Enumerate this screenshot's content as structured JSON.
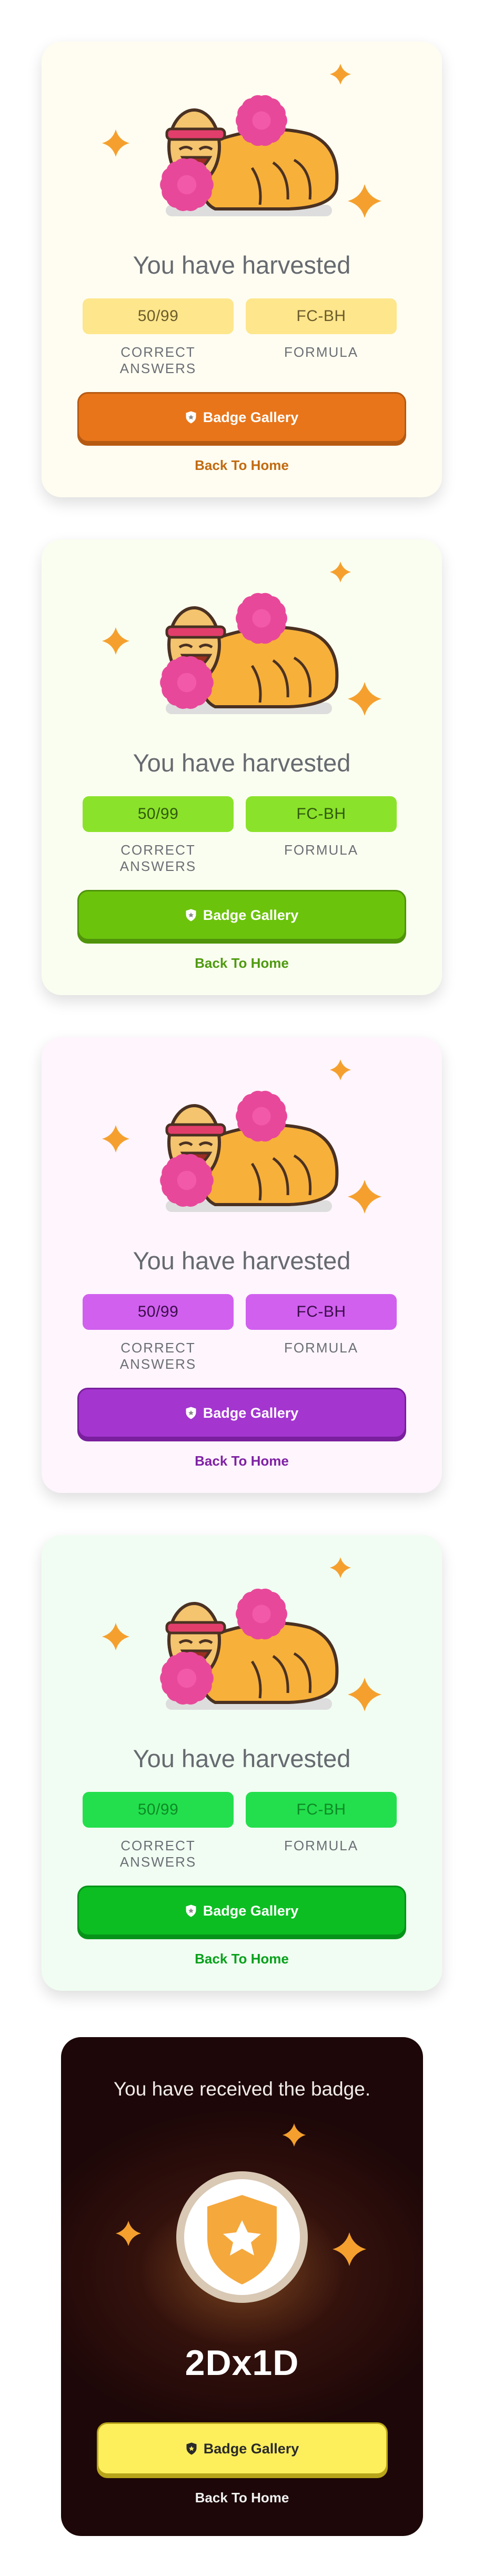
{
  "results": [
    {
      "theme": "orange",
      "colors": {
        "bg": "#fffdf1",
        "pill": "#fde68c",
        "pill_text": "#6d5c2a",
        "button": "#e8751a",
        "button_border": "#b65a12",
        "link": "#c26a10"
      },
      "title": "You have harvested",
      "correct_answers": {
        "value": "50/99",
        "caption": "CORRECT ANSWERS"
      },
      "formula": {
        "value": "FC-BH",
        "caption": "FORMULA"
      },
      "gallery_button": "Badge Gallery",
      "back_link": "Back To Home"
    },
    {
      "theme": "lime",
      "colors": {
        "bg": "#fafef0",
        "pill": "#8be22b",
        "pill_text": "#2f5a0b",
        "button": "#6cc30c",
        "button_border": "#4f940a",
        "link": "#4f9a10"
      },
      "title": "You have harvested",
      "correct_answers": {
        "value": "50/99",
        "caption": "CORRECT ANSWERS"
      },
      "formula": {
        "value": "FC-BH",
        "caption": "FORMULA"
      },
      "gallery_button": "Badge Gallery",
      "back_link": "Back To Home"
    },
    {
      "theme": "purple",
      "colors": {
        "bg": "#fef5fd",
        "pill": "#d160ef",
        "pill_text": "#3a0d48",
        "button": "#a435cf",
        "button_border": "#7a1f9e",
        "link": "#7f21a4"
      },
      "title": "You have harvested",
      "correct_answers": {
        "value": "50/99",
        "caption": "CORRECT ANSWERS"
      },
      "formula": {
        "value": "FC-BH",
        "caption": "FORMULA"
      },
      "gallery_button": "Badge Gallery",
      "back_link": "Back To Home"
    },
    {
      "theme": "green",
      "colors": {
        "bg": "#f1fdf2",
        "pill": "#23df4d",
        "pill_text": "#0d8a26",
        "button": "#0cbe22",
        "button_border": "#07931a",
        "link": "#09a11c"
      },
      "title": "You have harvested",
      "correct_answers": {
        "value": "50/99",
        "caption": "CORRECT ANSWERS"
      },
      "formula": {
        "value": "FC-BH",
        "caption": "FORMULA"
      },
      "gallery_button": "Badge Gallery",
      "back_link": "Back To Home"
    }
  ],
  "badge_received": {
    "heading": "You have received the badge.",
    "badge_name": "2Dx1D",
    "gallery_button": "Badge Gallery",
    "back_link": "Back To Home",
    "colors": {
      "bg": "#1d0708",
      "button": "#fdef5c",
      "badge": "#f5a83c",
      "ring": "#d8c8b4"
    }
  },
  "icons": [
    "sparkle-icon",
    "shield-icon",
    "star-icon"
  ]
}
